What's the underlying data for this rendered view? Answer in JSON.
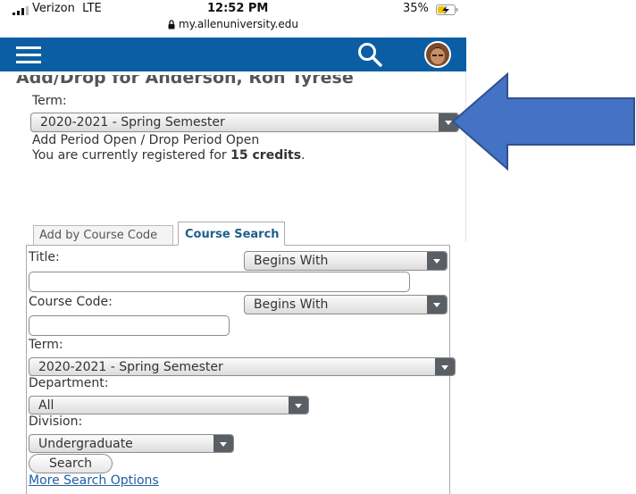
{
  "status_bar": {
    "carrier": "Verizon  LTE",
    "time": "12:52 PM",
    "url": "my.allenuniversity.edu",
    "battery": "35%"
  },
  "nav": {
    "menu_icon": "hamburger-menu-icon",
    "search_icon": "search-icon",
    "avatar_icon": "user-avatar"
  },
  "page": {
    "title_partial": "Add/Drop for Anderson, Ron Tyrese",
    "term_label": "Term:",
    "term_value": "2020-2021 - Spring Semester",
    "period_status": "Add Period Open / Drop Period Open",
    "registered_prefix": "You are currently registered for ",
    "registered_credits": "15 credits",
    "registered_suffix": "."
  },
  "tabs": [
    {
      "label": "Add by Course Code",
      "active": false
    },
    {
      "label": "Course Search",
      "active": true
    }
  ],
  "search_form": {
    "title_label": "Title:",
    "title_match": "Begins With",
    "title_value": "",
    "course_code_label": "Course Code:",
    "course_code_match": "Begins With",
    "course_code_value": "",
    "term_label": "Term:",
    "term_value": "2020-2021 - Spring Semester",
    "department_label": "Department:",
    "department_value": "All",
    "division_label": "Division:",
    "division_value": "Undergraduate",
    "search_button": "Search",
    "more_options_link": "More Search Options"
  },
  "annotation": {
    "arrow_color": "#4472c4"
  },
  "colors": {
    "nav_bar": "#0b5ea3",
    "active_tab_text": "#1f5f8b",
    "link": "#1f5fa7",
    "dropdown_button": "#5a5f66"
  }
}
